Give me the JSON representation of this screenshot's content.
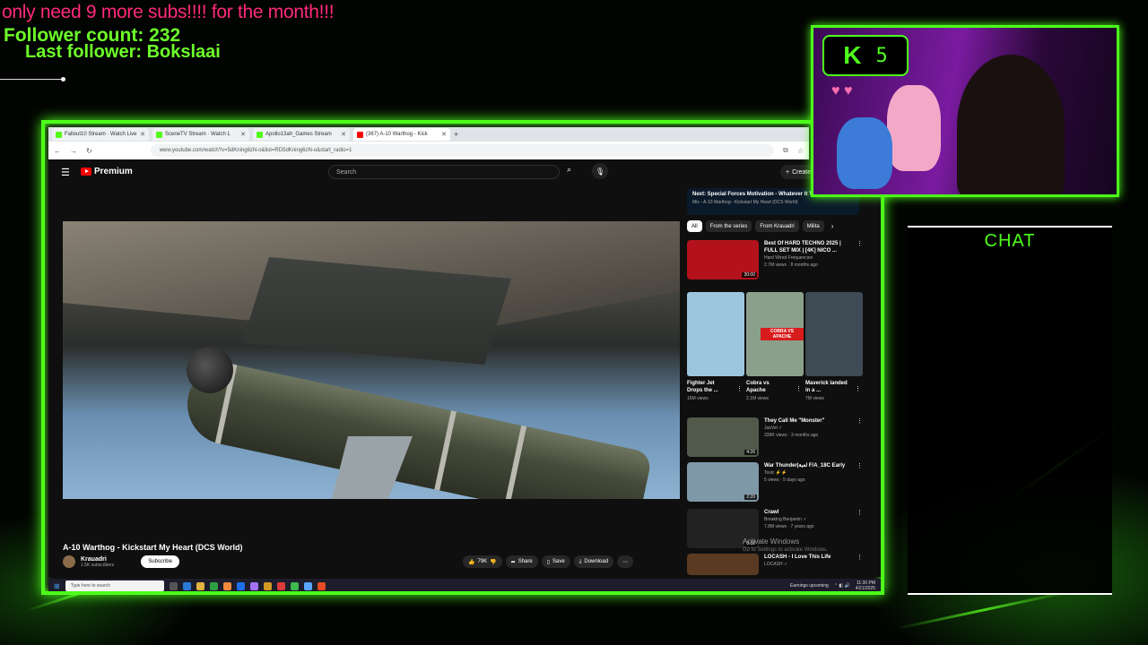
{
  "overlay": {
    "sub_goal": "only need 9 more subs!!!! for the month!!!",
    "follower_count": "Follower count: 232",
    "last_follower": "Last follower: Bokslaai"
  },
  "browser": {
    "tabs": [
      {
        "label": "Fallout10 Stream · Watch Live",
        "icon_color": "#53fc18"
      },
      {
        "label": "SceneTV Stream · Watch L",
        "icon_color": "#53fc18"
      },
      {
        "label": "Apollo13ah_Games Stream",
        "icon_color": "#53fc18"
      },
      {
        "label": "(367) A-10 Warthog - Kick",
        "icon_color": "#ff0000"
      }
    ],
    "new_tab": "+",
    "url": "www.youtube.com/watch?v=5dKning6zN-o&list=RD5dKning6zN-o&start_radio=1"
  },
  "youtube": {
    "brand": "Premium",
    "search_placeholder": "Search",
    "create_label": "Create",
    "video_title": "A-10 Warthog - Kickstart My Heart (DCS World)",
    "channel_name": "Krauadri",
    "channel_subs": "1.5K subscribers",
    "subscribe_label": "Subscribe",
    "like_count": "79K",
    "share_label": "Share",
    "save_label": "Save",
    "download_label": "Download",
    "next_title": "Next: Special Forces Motivation - Whatever It Takes",
    "next_sub": "Mix - A-10 Warthog - Kickstart My Heart (DCS World)",
    "chips": [
      "All",
      "From the series",
      "From Krauadri",
      "Milita"
    ],
    "recs": [
      {
        "title": "Best Of HARD TECHNO 2025 | FULL SET MIX | [4K] NICO ...",
        "meta1": "Hard Wired Frequencies",
        "meta2": "2.7M views · 8 months ago",
        "duration": "30:00",
        "color": "#b3121c"
      },
      {
        "title": "They Call Me \"Monster\"",
        "meta1": "JasVel ✓",
        "meta2": "339K views · 3 months ago",
        "duration": "4:26",
        "color": "#51594a"
      },
      {
        "title": "War Thunder|لعبة F/A_18C Early",
        "meta1": "Toxic ⚡⚡",
        "meta2": "5 views · 5 days ago",
        "duration": "2:20",
        "color": "#7e98a8"
      },
      {
        "title": "Crawl",
        "meta1": "Breaking Benjamin ✓",
        "meta2": "7.8M views · 7 years ago",
        "duration": "3:32",
        "color": "#222"
      },
      {
        "title": "LOCASH - I Love This Life",
        "meta1": "LOCASH ✓",
        "meta2": "",
        "duration": "",
        "color": "#5a3a22"
      }
    ],
    "shorts": [
      {
        "title": "Fighter Jet Drops the ...",
        "meta": "16M views",
        "color": "#9ec5de"
      },
      {
        "title": "Cobra vs Apache",
        "meta": "2.1M views",
        "color": "#8aa08a",
        "badge": "COBRA VS APACHE"
      },
      {
        "title": "Maverick landed in a ...",
        "meta": "7M views",
        "color": "#3e4a54"
      }
    ],
    "activate_title": "Activate Windows",
    "activate_sub": "Go to Settings to activate Windows."
  },
  "taskbar": {
    "search_placeholder": "Type here to search",
    "news": "Earnings upcoming",
    "time": "11:30 PM",
    "date": "4/21/2025"
  },
  "cam": {
    "badge_number": "5",
    "badge_icon": "K"
  },
  "chat": {
    "title": "CHAT"
  },
  "colors": {
    "accent": "#4dff1a",
    "sub_goal": "#ff2a7a"
  }
}
